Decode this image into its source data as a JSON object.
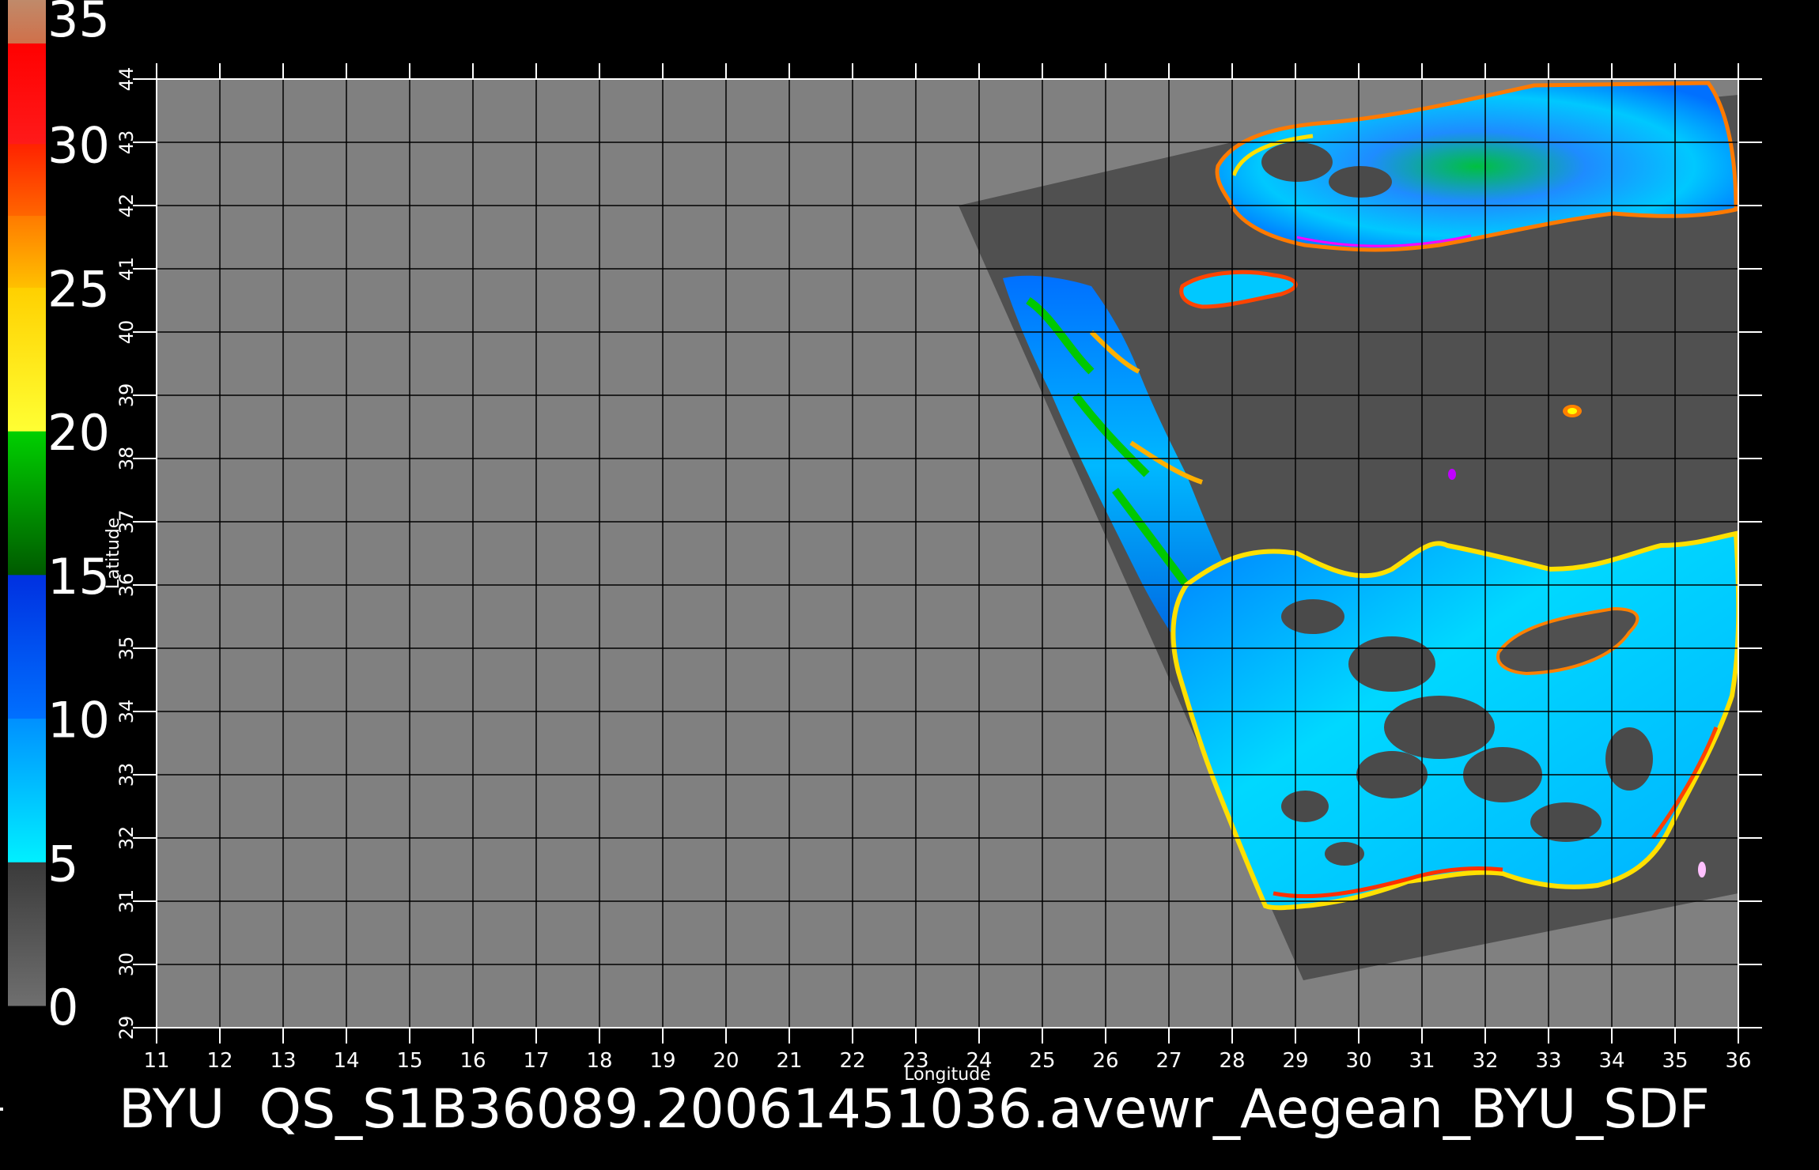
{
  "colorbar": {
    "labels": [
      "35",
      "30",
      "25",
      "20",
      "15",
      "10",
      "5",
      "0"
    ],
    "range": [
      0,
      35
    ],
    "segments": [
      {
        "from": 0,
        "to": 5,
        "colors": [
          "#6f6f6f",
          "#3a3a3a"
        ]
      },
      {
        "from": 5,
        "to": 10,
        "colors": [
          "#00f0ff",
          "#0090ff"
        ]
      },
      {
        "from": 10,
        "to": 15,
        "colors": [
          "#0070ff",
          "#0030e0"
        ]
      },
      {
        "from": 15,
        "to": 20,
        "colors": [
          "#005a00",
          "#00d000"
        ]
      },
      {
        "from": 20,
        "to": 25,
        "colors": [
          "#ffff33",
          "#ffd000"
        ]
      },
      {
        "from": 25,
        "to": 27.5,
        "colors": [
          "#ffc000",
          "#ff7a00"
        ]
      },
      {
        "from": 27.5,
        "to": 30,
        "colors": [
          "#ff6600",
          "#ff2200"
        ]
      },
      {
        "from": 30,
        "to": 33.5,
        "colors": [
          "#ff1a1a",
          "#ff0000"
        ]
      },
      {
        "from": 33.5,
        "to": 35,
        "colors": [
          "#d0704a",
          "#c08a6a"
        ]
      }
    ]
  },
  "axes": {
    "xlabel": "Longitude",
    "ylabel": "Latitude",
    "xticks": [
      "11",
      "12",
      "13",
      "14",
      "15",
      "16",
      "17",
      "18",
      "19",
      "20",
      "21",
      "22",
      "23",
      "24",
      "25",
      "26",
      "27",
      "28",
      "29",
      "30",
      "31",
      "32",
      "33",
      "34",
      "35",
      "36"
    ],
    "yticks": [
      "29",
      "30",
      "31",
      "32",
      "33",
      "34",
      "35",
      "36",
      "37",
      "38",
      "39",
      "40",
      "41",
      "42",
      "43",
      "44"
    ],
    "xlim": [
      11,
      36
    ],
    "ylim": [
      29,
      44
    ]
  },
  "map": {
    "background_color": "#808080",
    "swath_color": "#505050",
    "grid_color": "#000000"
  },
  "title": "BYU  QS_S1B36089.20061451036.avewr_Aegean_BYU_SDF"
}
